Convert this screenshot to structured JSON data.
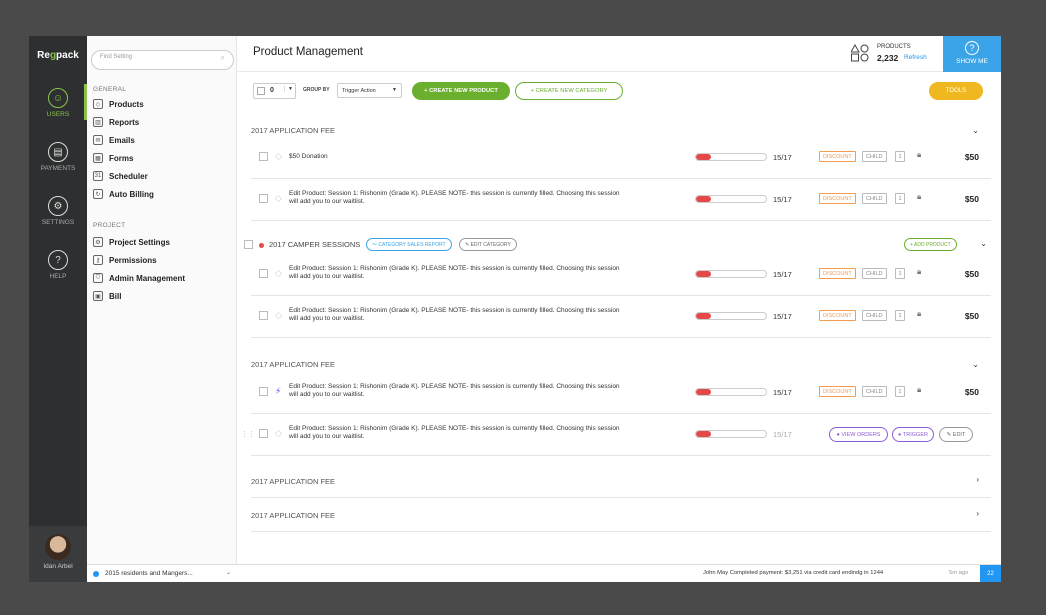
{
  "rail": {
    "logo_pre": "Re",
    "logo_accent": "g",
    "logo_post": "pack",
    "items": [
      {
        "label": "USERS",
        "icon": "user-icon"
      },
      {
        "label": "PAYMENTS",
        "icon": "payments-icon"
      },
      {
        "label": "SETTINGS",
        "icon": "settings-icon"
      },
      {
        "label": "HELP",
        "icon": "help-icon"
      }
    ],
    "user_name": "Idan Arbel"
  },
  "nav": {
    "search_placeholder": "Find Setting",
    "general_label": "GENERAL",
    "general_items": [
      "Products",
      "Reports",
      "Emails",
      "Forms",
      "Scheduler",
      "Auto Billing"
    ],
    "project_label": "PROJECT",
    "project_items": [
      "Project Settings",
      "Permissions",
      "Admin Management",
      "Bill"
    ],
    "footer": "2015 residents and Mangers..."
  },
  "header": {
    "title": "Product Management",
    "products_label": "PRODUCTS",
    "products_count": "2,232",
    "refresh": "Refresh",
    "show_me": "SHOW ME"
  },
  "toolbar": {
    "count": "0",
    "group_by": "GROUP BY",
    "trigger": "Trigger Action",
    "create_product": "+  CREATE NEW PRODUCT",
    "create_category": "+  CREATE NEW CATEGORY",
    "tools": "TOOLS"
  },
  "groups": {
    "g1_title": "2017 APPLICATION FEE",
    "g2_title": "2017 CAMPER SESSIONS",
    "g2_sales": "CATEGORY SALES REPORT",
    "g2_edit": "EDIT CATEGORY",
    "g2_add": "+ ADD PRODUCT",
    "g3_title": "2017 APPLICATION FEE",
    "g4_title": "2017 APPLICATION FEE",
    "g5_title": "2017 APPLICATION FEE"
  },
  "rows": {
    "donation": "$50 Donation",
    "session": "Edit Product: Session 1: Rishonim (Grade K). PLEASE NOTE- this session is currently filled. Choosing this session will add you to our waitlist.",
    "ratio": "15/17",
    "progress": 0.22,
    "discount": "DISCOUNT",
    "child": "CHILD",
    "num": "1",
    "price": "$50",
    "view_orders": "VIEW ORDERS",
    "trigger": "TRIGGER",
    "edit": "EDIT"
  },
  "status": {
    "message": "John May Completed payment: $3,251 via credit card endindg in 1244",
    "ago": "5m ago",
    "badge": "22"
  },
  "colors": {
    "accent_green": "#6aaf2e",
    "accent_blue": "#3ba3e8",
    "tools_yellow": "#f0b820",
    "progress_red": "#e54848"
  }
}
